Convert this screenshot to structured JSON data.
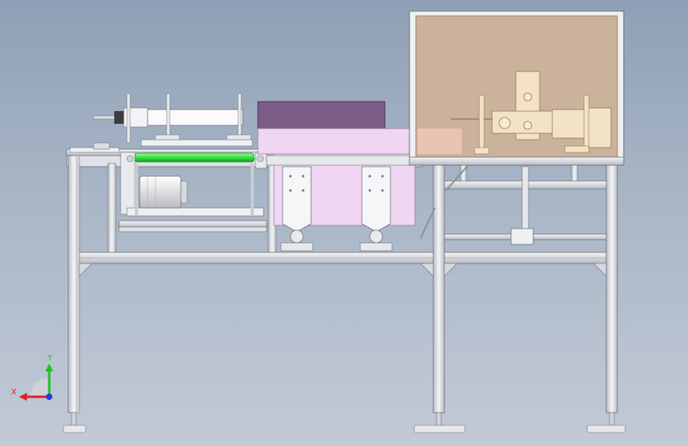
{
  "viewport": {
    "background_top": "#8f9fb5",
    "background_bottom": "#c2cad6"
  },
  "colors": {
    "frame_steel": "#e4e6ea",
    "frame_edge": "#6c7078",
    "enclosure_fill": "#cbb29a",
    "enclosure_frame": "#eef0f2",
    "hopper_purple": "#7e5c88",
    "hopper_pink": "#f0d6f2",
    "conveyor_roller": "#2ee63a",
    "fixture_tan": "#f3e2c3",
    "motor_body": "#f2f2f2"
  },
  "triad": {
    "x_label": "X",
    "y_label": "Y",
    "x_color": "#e02020",
    "y_color": "#20c020",
    "z_color": "#2040e0"
  }
}
